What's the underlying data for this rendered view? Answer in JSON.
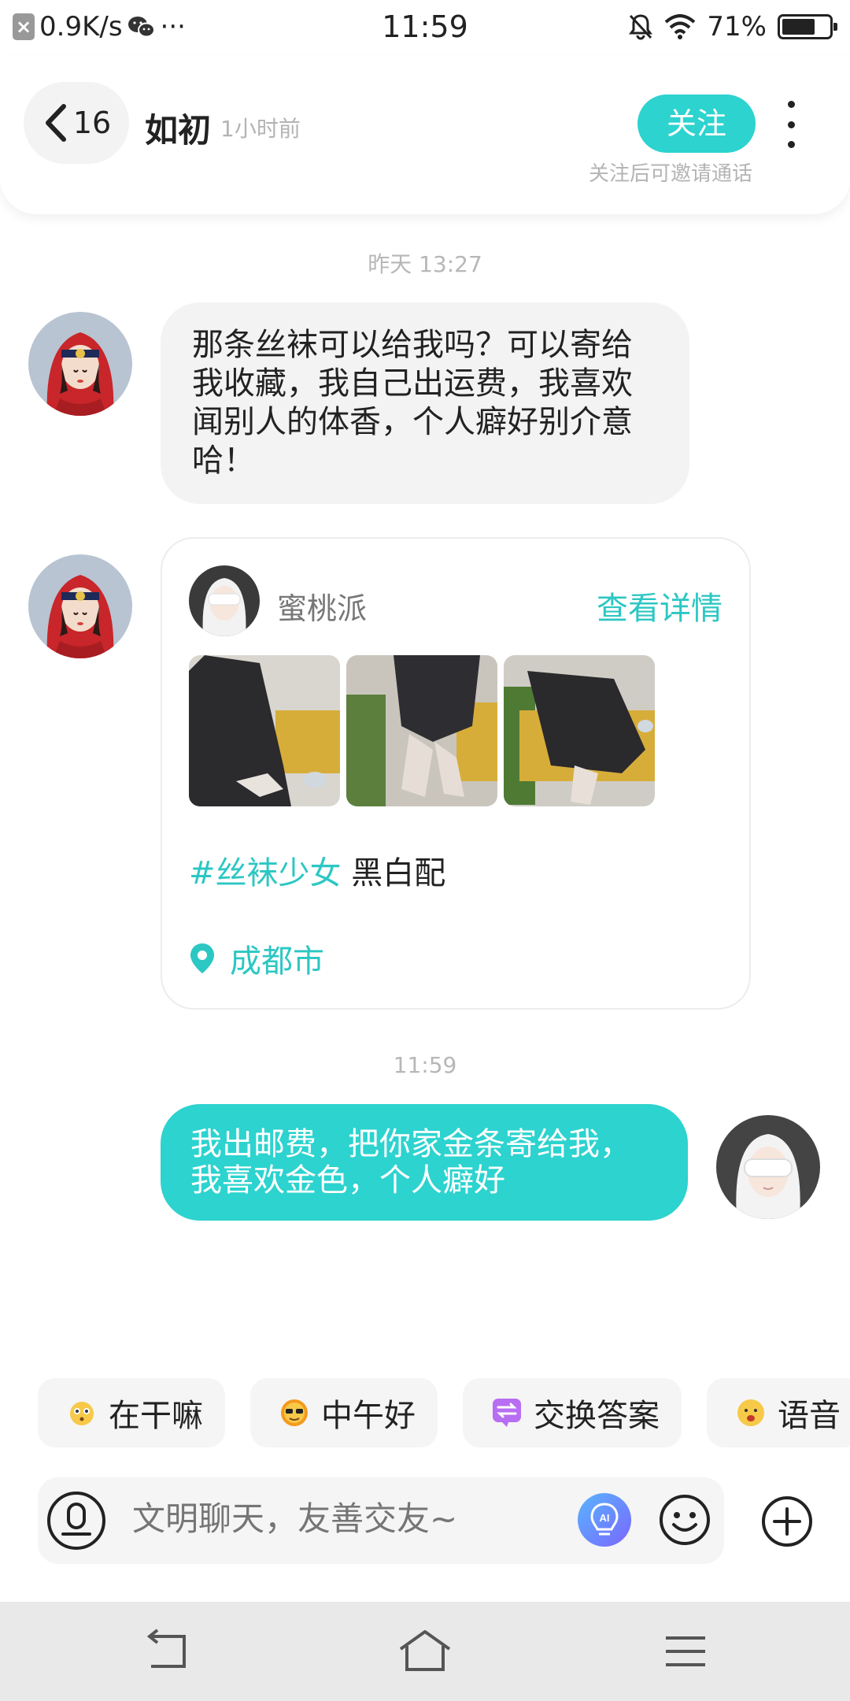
{
  "status_bar": {
    "net_speed": "0.9K/s",
    "dots": "···",
    "time": "11:59",
    "battery": "71%",
    "battery_level": 0.71
  },
  "header": {
    "unread_count": "16",
    "nickname": "如初",
    "last_seen": "1小时前",
    "follow_label": "关注",
    "follow_hint": "关注后可邀请通话"
  },
  "messages": {
    "ts1": "昨天 13:27",
    "msg1": "那条丝袜可以给我吗？可以寄给我收藏，我自己出运费，我喜欢闻别人的体香，个人癖好别介意哈！",
    "card": {
      "author": "蜜桃派",
      "detail_link": "查看详情",
      "tag": "#丝袜少女",
      "caption": " 黑白配",
      "location": "成都市"
    },
    "ts2": "11:59",
    "msg2": "我出邮费，把你家金条寄给我，我喜欢金色，个人癖好"
  },
  "quick_replies": [
    "在干嘛",
    "中午好",
    "交换答案",
    "语音"
  ],
  "input": {
    "placeholder": "文明聊天，友善交友~"
  },
  "colors": {
    "accent": "#2cd3cf",
    "link": "#2cc7c3",
    "bubble_in": "#f3f3f3"
  },
  "icons": {
    "back": "chevron-left-icon",
    "more": "more-vertical-icon",
    "location": "location-pin-icon",
    "voice": "voice-icon",
    "ai": "ai-bulb-icon",
    "emoji": "smiley-icon",
    "plus": "plus-circle-icon"
  }
}
